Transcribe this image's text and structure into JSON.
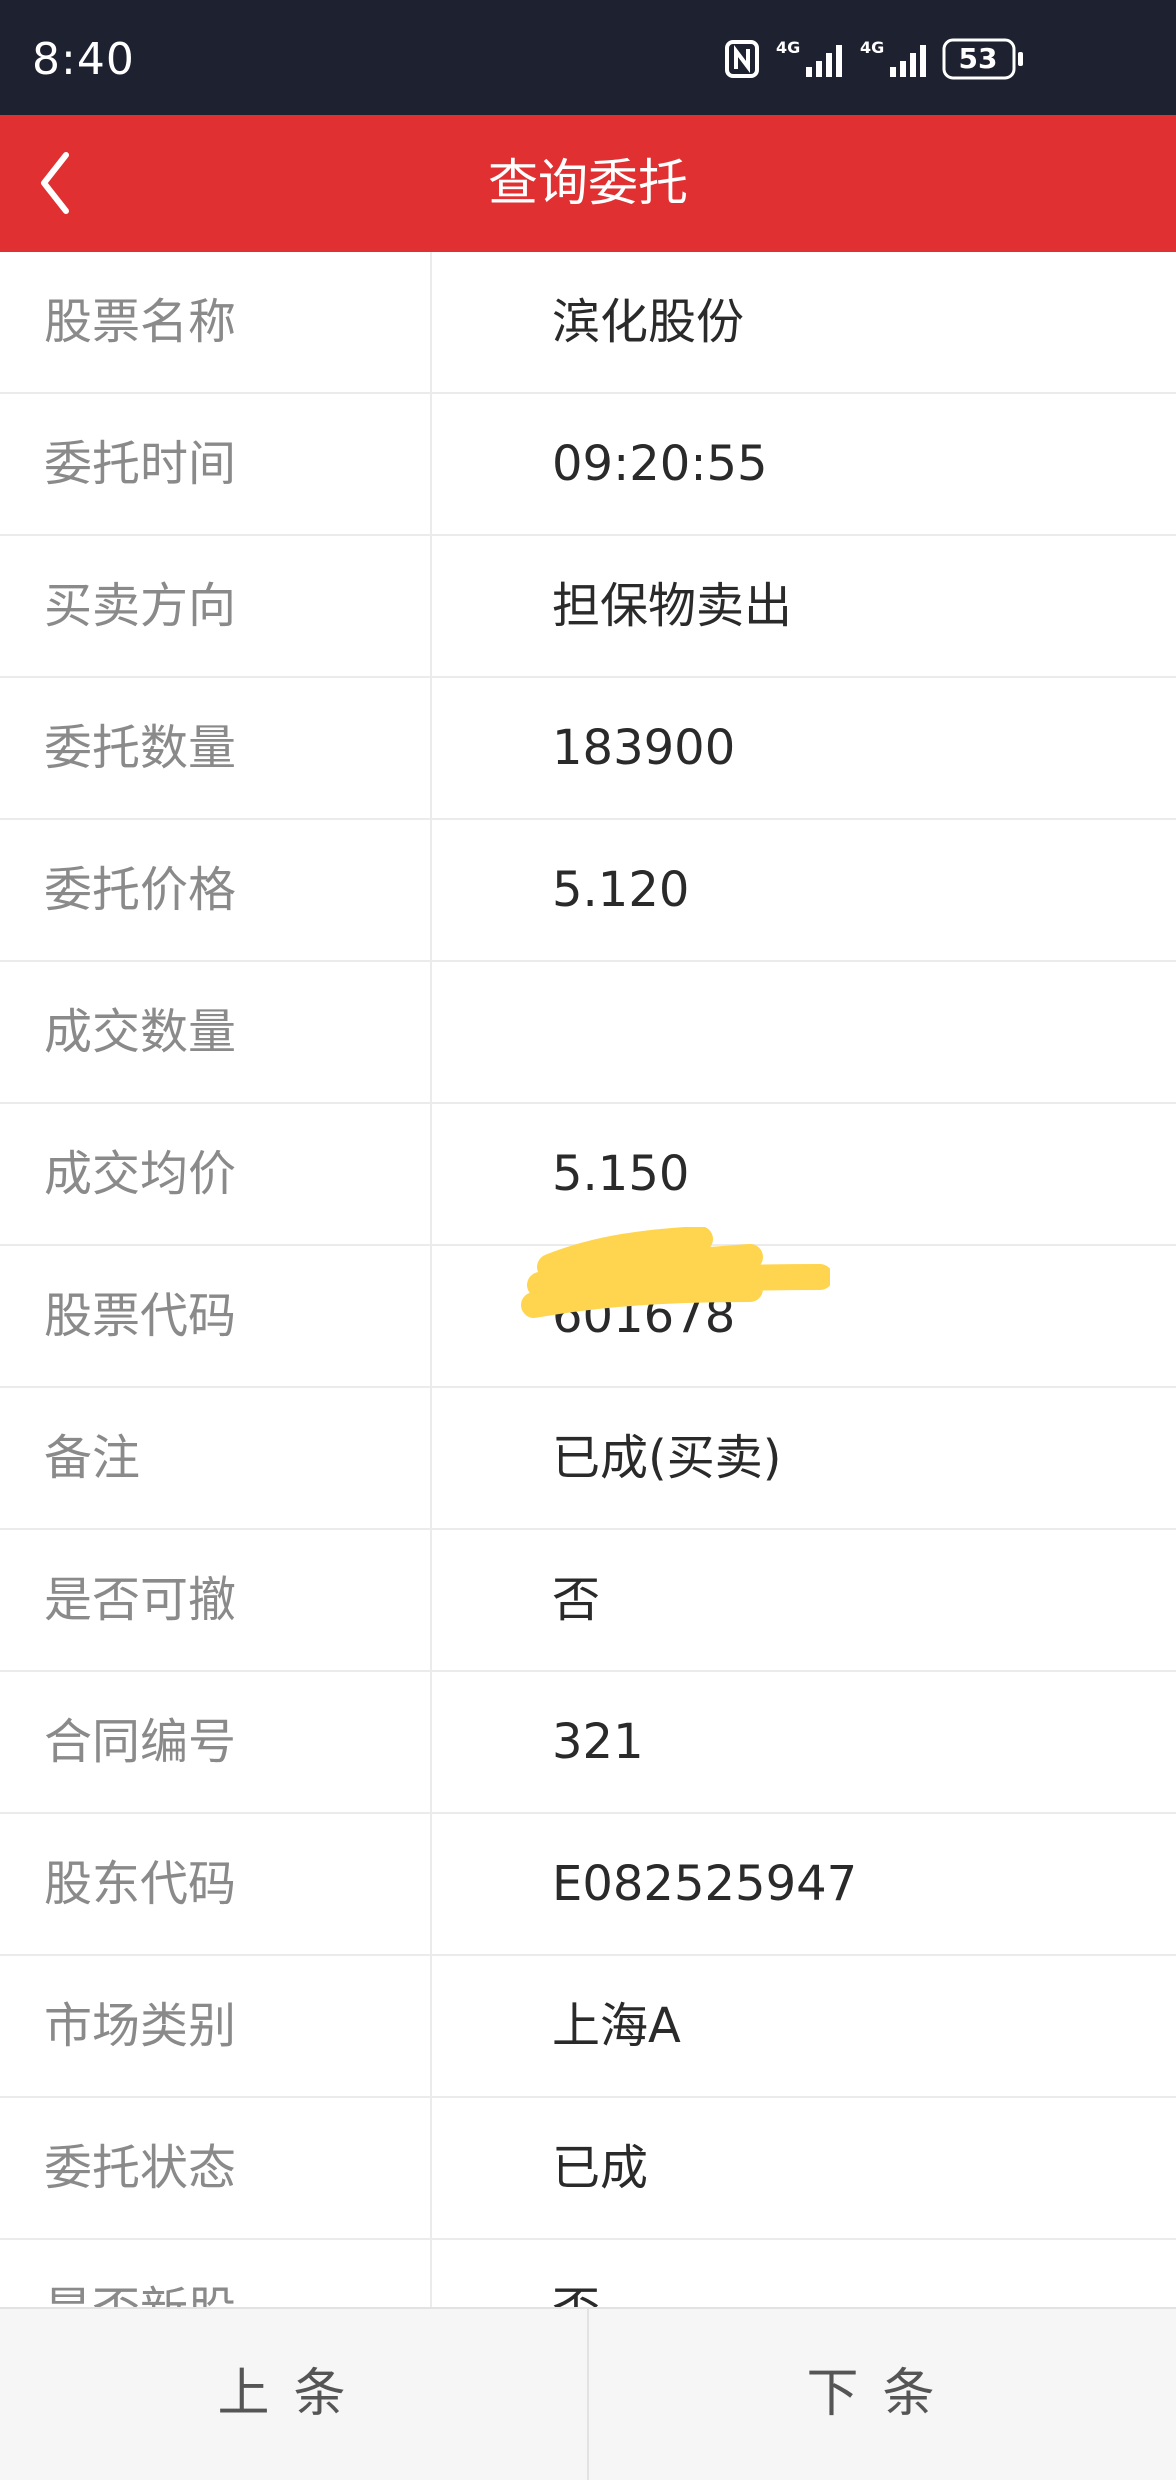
{
  "status_bar": {
    "time": "8:40",
    "battery": "53",
    "icons": [
      "nfc-icon",
      "signal-4g-icon",
      "signal-4g-icon",
      "battery-icon"
    ]
  },
  "header": {
    "title": "查询委托",
    "back_icon": "chevron-left-icon"
  },
  "rows": [
    {
      "label": "股票名称",
      "value": "滨化股份"
    },
    {
      "label": "委托时间",
      "value": "09:20:55"
    },
    {
      "label": "买卖方向",
      "value": "担保物卖出"
    },
    {
      "label": "委托数量",
      "value": "183900"
    },
    {
      "label": "委托价格",
      "value": "5.120"
    },
    {
      "label": "成交数量",
      "value": ""
    },
    {
      "label": "成交均价",
      "value": "5.150"
    },
    {
      "label": "股票代码",
      "value": "601678"
    },
    {
      "label": "备注",
      "value": "已成(买卖)"
    },
    {
      "label": "是否可撤",
      "value": "否"
    },
    {
      "label": "合同编号",
      "value": "321"
    },
    {
      "label": "股东代码",
      "value": "E082525947"
    },
    {
      "label": "市场类别",
      "value": "上海A"
    },
    {
      "label": "委托状态",
      "value": "已成"
    },
    {
      "label": "是否新股",
      "value": "否"
    }
  ],
  "footer": {
    "prev_label": "上条",
    "next_label": "下条"
  },
  "colors": {
    "header_red": "#e03032",
    "status_bar": "#1e2230",
    "redaction_yellow": "#ffd54f"
  }
}
